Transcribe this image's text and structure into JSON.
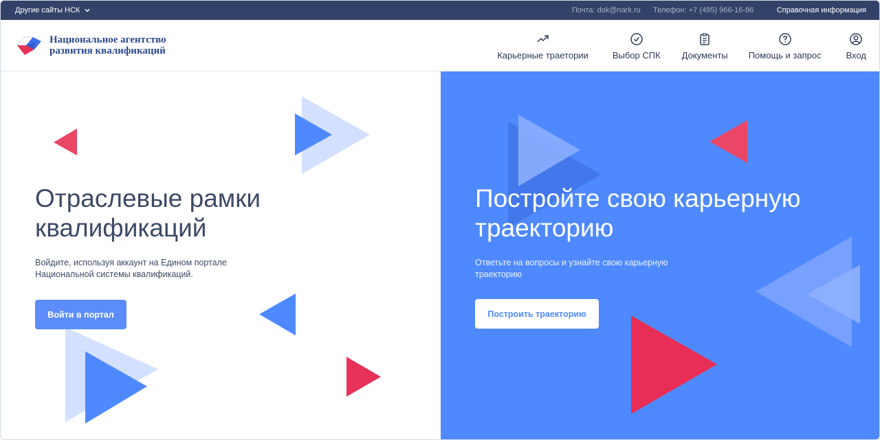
{
  "topbar": {
    "other_sites": "Другие сайты НСК",
    "mail": "Почта: dok@nark.ru",
    "phone": "Телефон: +7 (495) 966-16-86",
    "help": "Справочная информация"
  },
  "header": {
    "logo_line1": "Национальное агентство",
    "logo_line2": "развития квалификаций",
    "nav": [
      {
        "label": "Карьерные траетории",
        "icon": "trending-up-icon"
      },
      {
        "label": "Выбор СПК",
        "icon": "check-circle-icon"
      },
      {
        "label": "Документы",
        "icon": "clipboard-icon"
      },
      {
        "label": "Помощь и запрос",
        "icon": "help-circle-icon"
      },
      {
        "label": "Вход",
        "icon": "user-circle-icon"
      }
    ]
  },
  "left": {
    "title": "Отраслевые рамки квалификаций",
    "description": "Войдите, используя аккаунт на Едином портале Национальной системы квалификаций.",
    "button": "Войти в портал"
  },
  "right": {
    "title": "Постройте свою карьерную траекторию",
    "description": "Ответьте на вопросы и узнайте свою карьерную траекторию",
    "button": "Построить траекторию"
  },
  "colors": {
    "topbar": "#334268",
    "accent_blue": "#4f89ff",
    "button_blue": "#5b8cf9",
    "red": "#e8325a",
    "light_blue": "#d3e0ff"
  }
}
